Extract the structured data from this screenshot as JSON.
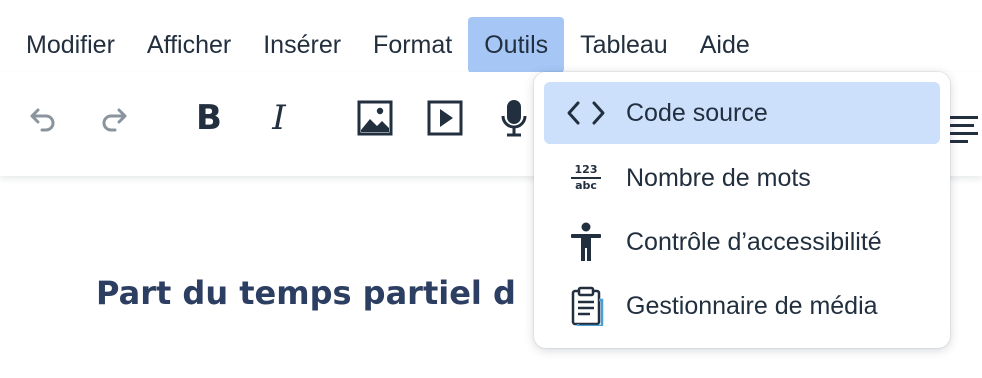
{
  "menubar": {
    "items": [
      {
        "label": "Modifier"
      },
      {
        "label": "Afficher"
      },
      {
        "label": "Insérer"
      },
      {
        "label": "Format"
      },
      {
        "label": "Outils"
      },
      {
        "label": "Tableau"
      },
      {
        "label": "Aide"
      }
    ],
    "active_index": 4
  },
  "toolbar": {
    "buttons": [
      {
        "icon": "undo-icon"
      },
      {
        "icon": "redo-icon"
      },
      {
        "icon": "bold-icon",
        "glyph": "B"
      },
      {
        "icon": "italic-icon",
        "glyph": "I"
      },
      {
        "icon": "image-icon"
      },
      {
        "icon": "media-icon"
      },
      {
        "icon": "microphone-icon"
      },
      {
        "icon": "align-icon"
      }
    ]
  },
  "editor": {
    "heading": "Part du temps partiel d"
  },
  "dropdown": {
    "items": [
      {
        "label": "Code source",
        "icon": "code-icon",
        "selected": true
      },
      {
        "label": "Nombre de mots",
        "icon": "word-count-icon",
        "icon_text_top": "123",
        "icon_text_bottom": "abc"
      },
      {
        "label": "Contrôle d’accessibilité",
        "icon": "accessibility-icon"
      },
      {
        "label": "Gestionnaire de média",
        "icon": "clipboard-icon"
      }
    ]
  },
  "colors": {
    "active_menu": "#a6c7f6",
    "selected_item": "#cce0fb",
    "text": "#222f3e",
    "disabled_icon": "#8a949e"
  }
}
